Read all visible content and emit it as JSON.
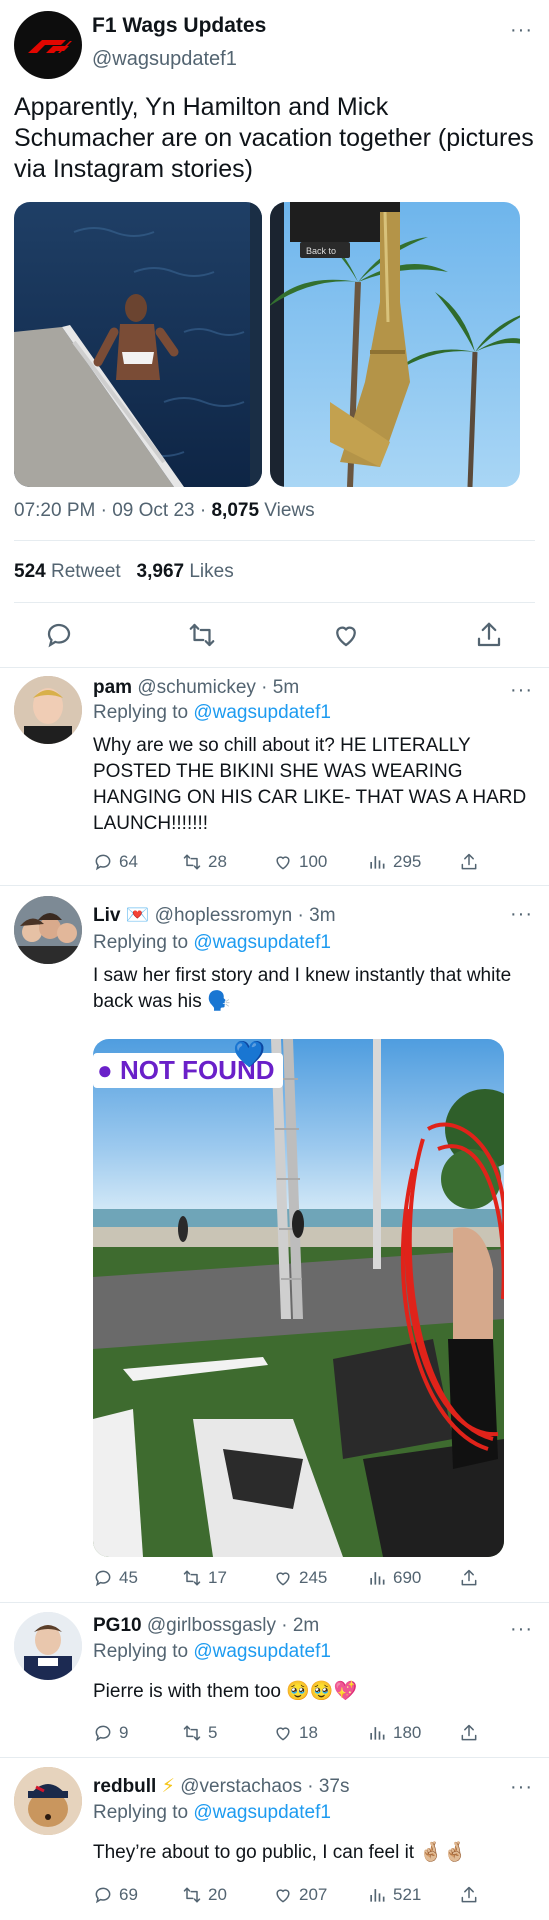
{
  "main": {
    "name": "F1 Wags Updates",
    "handle": "@wagsupdatef1",
    "text": "Apparently, Yn Hamilton and Mick Schumacher are on vacation together (pictures via Instagram stories)",
    "photo2_tag": "Back to",
    "time": "07:20 PM · 09 Oct 23 · ",
    "views_count": "8,075",
    "views_label": " Views",
    "retweets_count": "524",
    "retweets_label": " Retweet",
    "likes_count": "3,967",
    "likes_label": " Likes"
  },
  "replies": [
    {
      "name": "pam",
      "handle": " @schumickey · 5m",
      "replying_prefix": "Replying to ",
      "replying_to": "@wagsupdatef1",
      "text": "Why are we so chill about it? HE LITERALLY POSTED THE BIKINI SHE WAS WEARING HANGING ON HIS CAR LIKE- THAT WAS A HARD LAUNCH!!!!!!!",
      "replies": "64",
      "retweets": "28",
      "likes": "100",
      "views": "295"
    },
    {
      "name": "Liv",
      "name_emoji": "💌",
      "handle": " @hoplessromyn · 3m",
      "replying_prefix": "Replying to ",
      "replying_to": "@wagsupdatef1",
      "text": "I saw her first story and I knew instantly that white back was his 🗣️",
      "image_tag": "NOT FOUND",
      "image_tag_emoji": "💙",
      "replies": "45",
      "retweets": "17",
      "likes": "245",
      "views": "690"
    },
    {
      "name": "PG10",
      "handle": " @girlbossgasly · 2m",
      "replying_prefix": "Replying to ",
      "replying_to": "@wagsupdatef1",
      "text": "Pierre is with them too 🥹🥹💖",
      "replies": "9",
      "retweets": "5",
      "likes": "18",
      "views": "180"
    },
    {
      "name": "redbull",
      "name_emoji": "⚡",
      "handle": " @verstachaos · 37s",
      "replying_prefix": "Replying to ",
      "replying_to": "@wagsupdatef1",
      "text": "They’re about to go public, I can feel it 🤞🏼🤞🏼",
      "replies": "69",
      "retweets": "20",
      "likes": "207",
      "views": "521"
    }
  ],
  "colors": {
    "link": "#1d9bf0",
    "secondary": "#536471",
    "divider": "#e6ecf0",
    "annotation_red": "#e0231a"
  },
  "icons": [
    "more-icon",
    "reply-icon",
    "retweet-icon",
    "like-icon",
    "share-icon",
    "views-icon"
  ]
}
